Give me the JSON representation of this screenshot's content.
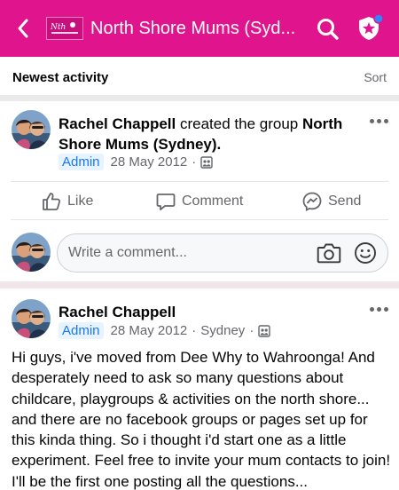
{
  "header": {
    "title": "North Shore Mums (Syd...",
    "logo_text": "North Shore Mums"
  },
  "activity": {
    "title": "Newest activity",
    "sort_label": "Sort"
  },
  "post1": {
    "author": "Rachel Chappell",
    "action_text": " created the group ",
    "group_name": "North Shore Mums (Sydney).",
    "badge": "Admin",
    "date": "28 May 2012",
    "separator": "·"
  },
  "actions": {
    "like": "Like",
    "comment": "Comment",
    "send": "Send"
  },
  "comment_box": {
    "placeholder": "Write a comment..."
  },
  "post2": {
    "author": "Rachel Chappell",
    "badge": "Admin",
    "date": "28 May 2012",
    "separator": "·",
    "location": "Sydney",
    "body": "Hi guys, i've moved from Dee Why to Wahroonga! And desperately need to ask so many questions about childcare, playgroups & activities on the north shore... and there are no facebook groups or pages set up for this kinda thing. So i thought i'd start one as a little experiment. Feel free to invite your mum contacts to join! I'll be the first one posting all the questions..."
  },
  "colors": {
    "brand": "#e0148c",
    "admin_badge_text": "#1877f2",
    "admin_badge_bg": "#e7f3ff"
  },
  "icons": [
    "back-chevron-icon",
    "group-logo",
    "search-icon",
    "admin-shield-icon",
    "more-options-icon",
    "group-privacy-icon",
    "like-icon",
    "comment-icon",
    "send-icon",
    "camera-icon",
    "emoji-icon"
  ]
}
